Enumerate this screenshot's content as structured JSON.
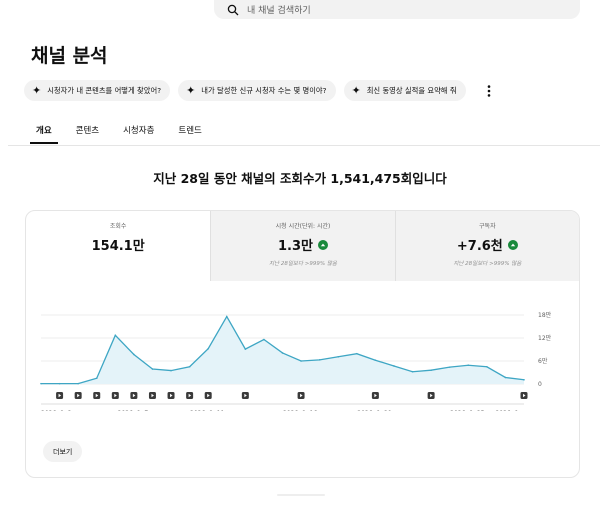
{
  "search": {
    "placeholder": "내 채널 검색하기"
  },
  "page_title": "채널 분석",
  "chips": [
    {
      "label": "시청자가 내 콘텐츠를 어떻게 찾았어?"
    },
    {
      "label": "내가 달성한 신규 시청자 수는 몇 명이야?"
    },
    {
      "label": "최신 동영상 실적을 요약해 줘"
    }
  ],
  "tabs": [
    {
      "label": "개요",
      "active": true
    },
    {
      "label": "콘텐츠",
      "active": false
    },
    {
      "label": "시청자층",
      "active": false
    },
    {
      "label": "트렌드",
      "active": false
    }
  ],
  "headline": "지난 28일 동안 채널의 조회수가 1,541,475회입니다",
  "metrics": [
    {
      "label": "조회수",
      "value": "154.1만",
      "compare": ""
    },
    {
      "label": "시청 시간(단위: 시간)",
      "value": "1.3만",
      "compare": "지난 28일보다 >999% 많음"
    },
    {
      "label": "구독자",
      "value": "+7.6천",
      "compare": "지난 28일보다 >999% 많음"
    }
  ],
  "colors": {
    "line": "#3ea6c4",
    "fill": "#e4f3f9",
    "up": "#1a8a3c",
    "grid": "#ececec"
  },
  "chart_data": {
    "type": "area",
    "x": [
      "2026. 9. 2.",
      "2026. 9. 3.",
      "2026. 9. 4.",
      "2026. 9. 5.",
      "2026. 9. 6.",
      "2026. 9. 7.",
      "2026. 9. 8.",
      "2026. 9. 9.",
      "2026. 9. 10.",
      "2026. 9. 11.",
      "2026. 9. 12.",
      "2026. 9. 13.",
      "2026. 9. 14.",
      "2026. 9. 15.",
      "2026. 9. 16.",
      "2026. 9. 17.",
      "2026. 9. 18.",
      "2026. 9. 19.",
      "2026. 9. 20.",
      "2026. 9. 21.",
      "2026. 9. 22.",
      "2026. 9. 23.",
      "2026. 9. 24.",
      "2026. 9. 25.",
      "2026. 9. 26.",
      "2026. 9. 27.",
      "2026. 9. 28."
    ],
    "values": [
      1000,
      1000,
      1000,
      15000,
      127000,
      77000,
      39000,
      35000,
      45000,
      92000,
      176000,
      91000,
      116000,
      81000,
      60000,
      63000,
      71000,
      79000,
      62000,
      47000,
      32000,
      36000,
      44000,
      49000,
      45000,
      17000,
      11000
    ],
    "video_markers": [
      "2026. 9. 3.",
      "2026. 9. 4.",
      "2026. 9. 5.",
      "2026. 9. 6.",
      "2026. 9. 7.",
      "2026. 9. 8.",
      "2026. 9. 9.",
      "2026. 9. 10.",
      "2026. 9. 11.",
      "2026. 9. 13.",
      "2026. 9. 16.",
      "2026. 9. 20.",
      "2026. 9. 23.",
      "2026. 9. 28."
    ],
    "x_tick_labels": [
      "2026. 9. 2.",
      "2026. 9. 7.",
      "2026. 9. 11.",
      "2026. 9. 16.",
      "2026. 9. 20.",
      "2026. 9. 25.",
      "2026. 9...."
    ],
    "x_ticks_at": [
      "2026. 9. 2.",
      "2026. 9. 7.",
      "2026. 9. 11.",
      "2026. 9. 16.",
      "2026. 9. 20.",
      "2026. 9. 25.",
      "2026. 9. 28."
    ],
    "y_ticks": [
      0,
      60000,
      120000,
      180000
    ],
    "y_tick_labels": [
      "0",
      "6만",
      "12만",
      "18만"
    ],
    "ylim": [
      0,
      180000
    ],
    "grid": true
  },
  "more_button": "더보기"
}
